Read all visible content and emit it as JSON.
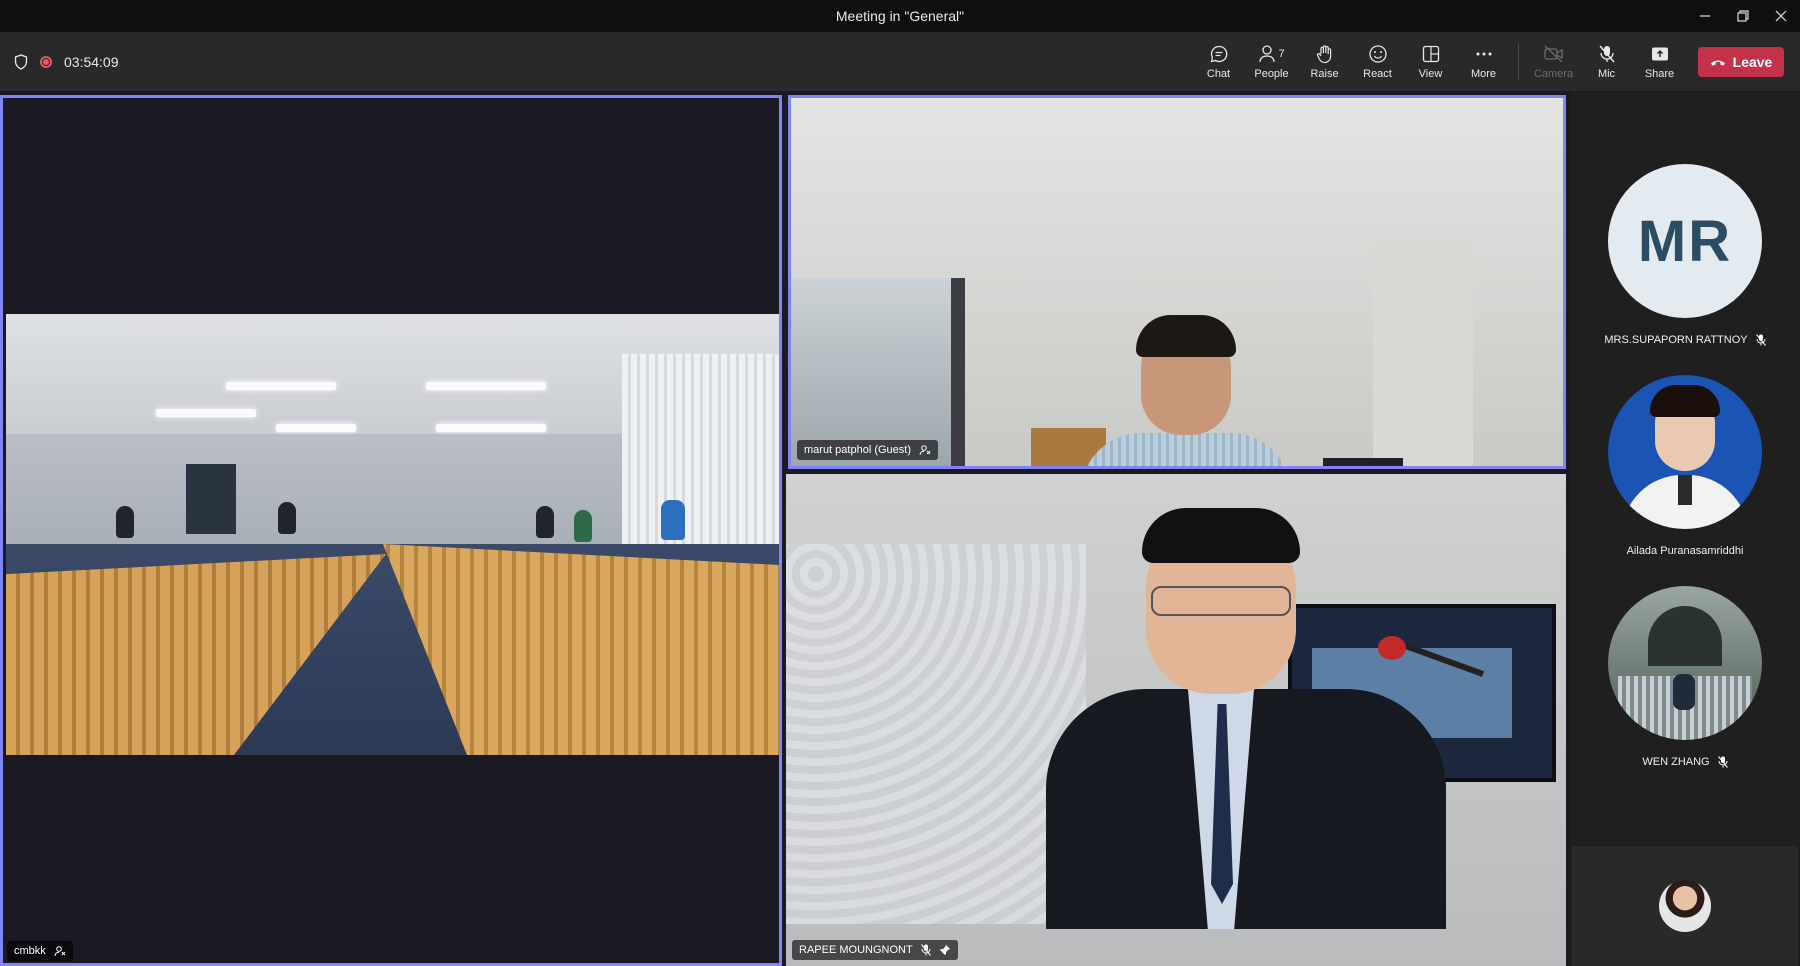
{
  "window": {
    "title": "Meeting in \"General\"",
    "controls": [
      "minimize",
      "restore",
      "close"
    ]
  },
  "toolbar": {
    "timer": "03:54:09",
    "buttons": {
      "chat": "Chat",
      "people": "People",
      "people_count": "7",
      "raise": "Raise",
      "react": "React",
      "view": "View",
      "more": "More",
      "camera": "Camera",
      "mic": "Mic",
      "share": "Share"
    },
    "leave": "Leave"
  },
  "tiles": {
    "room": {
      "name": "cmbkk"
    },
    "guest": {
      "name": "marut patphol (Guest)"
    },
    "speaker": {
      "name": "RAPEE MOUNGNONT"
    }
  },
  "rail": {
    "participants": [
      {
        "initials": "MR",
        "name": "MRS.SUPAPORN RATTNOY",
        "muted": true
      },
      {
        "name": "Ailada Puranasamriddhi",
        "muted": false
      },
      {
        "name": "WEN ZHANG",
        "muted": true
      }
    ]
  },
  "colors": {
    "accent": "#7f85f5",
    "leave": "#c4314b",
    "recording": "#e35a5a"
  }
}
